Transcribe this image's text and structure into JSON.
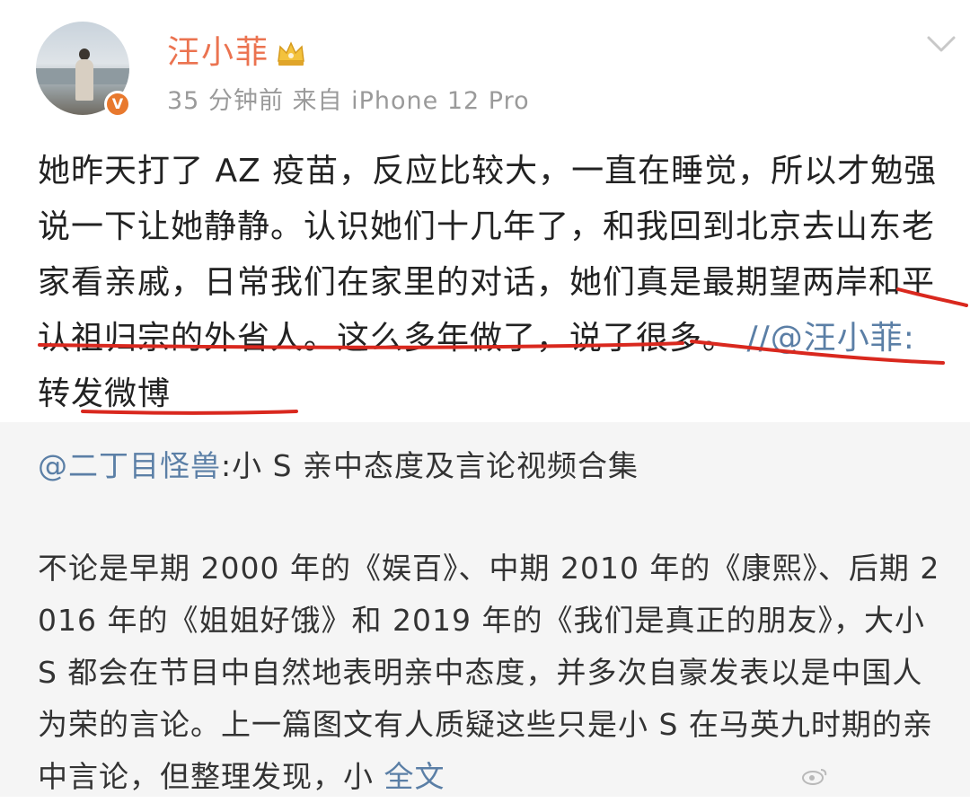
{
  "header": {
    "username": "汪小菲",
    "verified_badge": "V",
    "meta": "35 分钟前  来自 iPhone 12 Pro",
    "icons": {
      "crown": "crown-icon",
      "menu": "chevron-down-icon"
    }
  },
  "post": {
    "text": "她昨天打了 AZ 疫苗，反应比较大，一直在睡觉，所以才勉强说一下让她静静。认识她们十几年了，和我回到北京去山东老家看亲戚，日常我们在家里的对话，她们真是最期望两岸和平认祖归宗的外省人。这么多年做了，说了很多。",
    "repost_ref": "//@汪小菲:",
    "repost_text": "转发微博"
  },
  "quoted": {
    "author": "@二丁目怪兽",
    "title": ":小 S 亲中态度及言论视频合集",
    "body": "不论是早期 2000 年的《娱百》、中期 2010 年的《康熙》、后期 2016 年的《姐姐好饿》和 2019 年的《我们是真正的朋友》，大小 S 都会在节目中自然地表明亲中态度，并多次自豪发表以是中国人为荣的言论。上一篇图文有人质疑这些只是小 S 在马英九时期的亲中言论，但整理发现，小",
    "full_text_link": "全文"
  },
  "colors": {
    "username": "#eb7350",
    "link": "#5b7fa6",
    "annotation": "#d9281e",
    "quoted_bg": "#f5f5f5"
  }
}
